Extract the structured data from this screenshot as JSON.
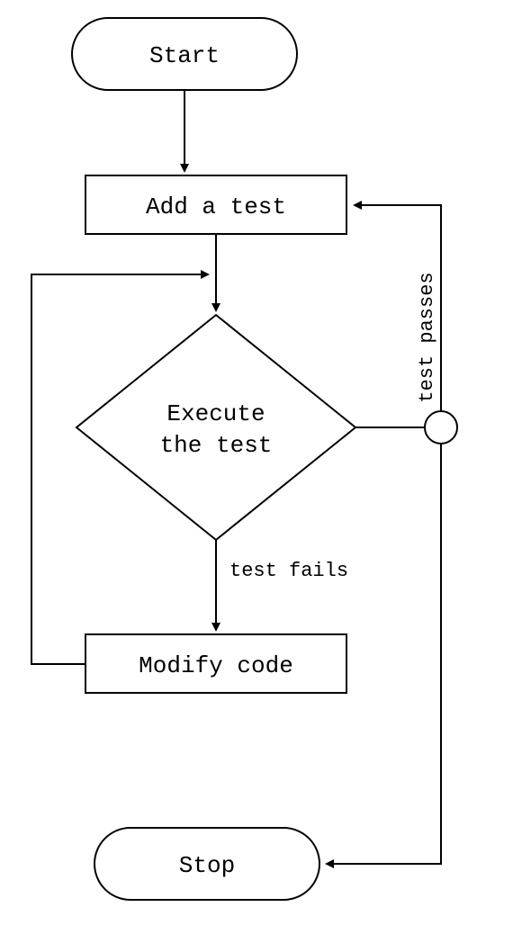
{
  "nodes": {
    "start": "Start",
    "add_test": "Add a test",
    "execute_l1": "Execute",
    "execute_l2": "the test",
    "modify": "Modify code",
    "stop": "Stop"
  },
  "edges": {
    "fail_label": "test fails",
    "pass_label": "test passes"
  }
}
